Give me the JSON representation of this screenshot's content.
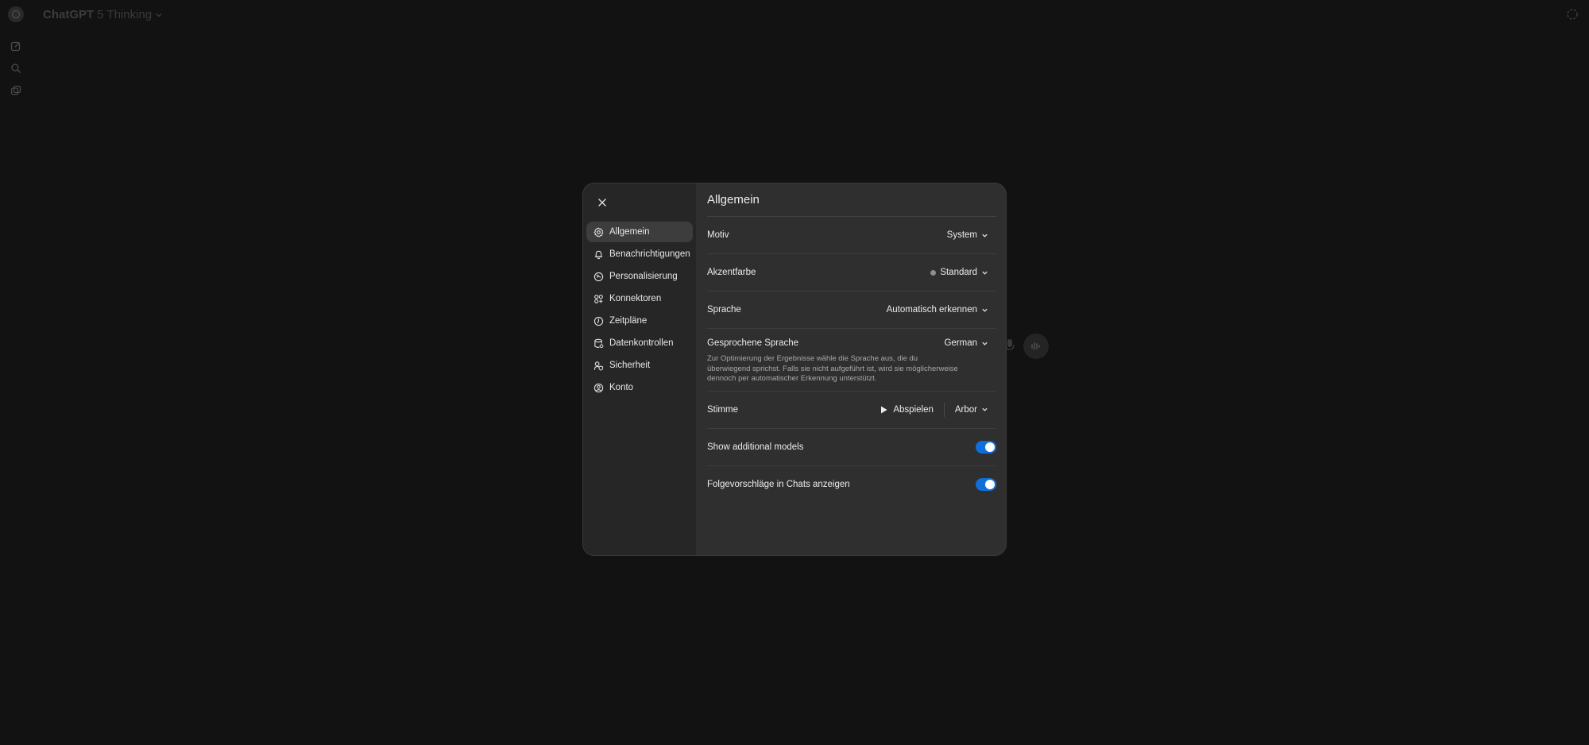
{
  "header": {
    "model_name": "ChatGPT",
    "model_variant": "5 Thinking"
  },
  "icons": {
    "logo": "openai-logo-icon",
    "new_chat": "edit-icon",
    "search": "search-icon",
    "library": "images-icon",
    "temporary": "dashed-circle-icon",
    "mic": "mic-icon",
    "voice": "voice-wave-icon"
  },
  "settings": {
    "title": "Allgemein",
    "nav": [
      {
        "label": "Allgemein",
        "icon": "gear-icon",
        "active": true
      },
      {
        "label": "Benachrichtigungen",
        "icon": "bell-icon"
      },
      {
        "label": "Personalisierung",
        "icon": "personalization-icon"
      },
      {
        "label": "Konnektoren",
        "icon": "connectors-icon"
      },
      {
        "label": "Zeitpläne",
        "icon": "clock-icon"
      },
      {
        "label": "Datenkontrollen",
        "icon": "database-icon"
      },
      {
        "label": "Sicherheit",
        "icon": "shield-icon"
      },
      {
        "label": "Konto",
        "icon": "user-circle-icon"
      }
    ],
    "theme": {
      "label": "Motiv",
      "value": "System"
    },
    "accent": {
      "label": "Akzentfarbe",
      "value": "Standard",
      "dot_color": "#8e8e8e"
    },
    "language": {
      "label": "Sprache",
      "value": "Automatisch erkennen"
    },
    "spoken": {
      "label": "Gesprochene Sprache",
      "value": "German",
      "hint": "Zur Optimierung der Ergebnisse wähle die Sprache aus, die du überwiegend sprichst. Falls sie nicht aufgeführt ist, wird sie möglicherweise dennoch per automatischer Erkennung unterstützt."
    },
    "voice": {
      "label": "Stimme",
      "play_label": "Abspielen",
      "value": "Arbor"
    },
    "additional_models": {
      "label": "Show additional models",
      "on": true
    },
    "followups": {
      "label": "Folgevorschläge in Chats anzeigen",
      "on": true
    },
    "toggle_color": "#0f6fd8"
  }
}
